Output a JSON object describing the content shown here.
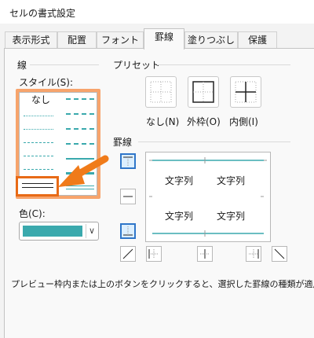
{
  "window": {
    "title": "セルの書式設定"
  },
  "tabs": [
    {
      "label": "表示形式"
    },
    {
      "label": "配置"
    },
    {
      "label": "フォント"
    },
    {
      "label": "罫線"
    },
    {
      "label": "塗りつぶし"
    },
    {
      "label": "保護"
    }
  ],
  "active_tab": "罫線",
  "line_group": {
    "title": "線",
    "style_label": "スタイル(S):",
    "none_label": "なし",
    "color_label": "色(C):",
    "color_value": "#3aa9ad"
  },
  "presets": {
    "title": "プリセット",
    "buttons": [
      {
        "label": "なし(N)",
        "icon": "border-none-icon"
      },
      {
        "label": "外枠(O)",
        "icon": "border-outline-icon"
      },
      {
        "label": "内側(I)",
        "icon": "border-inside-icon"
      }
    ]
  },
  "border_group": {
    "title": "罫線",
    "preview_text": [
      "文字列",
      "文字列",
      "文字列",
      "文字列"
    ]
  },
  "footer_note": "プレビュー枠内または上のボタンをクリックすると、選択した罫線の種類が適用されます。",
  "colors": {
    "accent_orange": "#e86a16",
    "teal": "#3aa9ad",
    "selected_blue": "#2f76c9"
  }
}
